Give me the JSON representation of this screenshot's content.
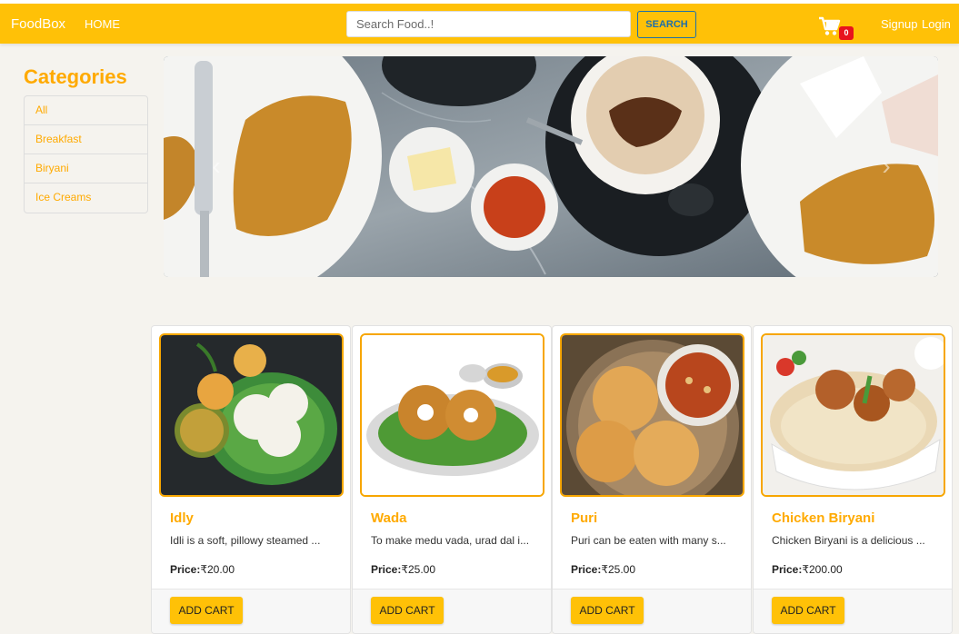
{
  "navbar": {
    "brand": "FoodBox",
    "home": "HOME",
    "search_placeholder": "Search Food..!",
    "search_button": "SEARCH",
    "cart_count": "0",
    "signup": "Signup",
    "login": "Login"
  },
  "categories": {
    "title": "Categories",
    "items": [
      "All",
      "Breakfast",
      "Biryani",
      "Ice Creams"
    ]
  },
  "carousel": {
    "prev_icon": "chevron-left-icon",
    "next_icon": "chevron-right-icon"
  },
  "products": [
    {
      "name": "Idly",
      "description": "Idli is a soft, pillowy steamed ...",
      "price_label": "Price:",
      "price": "₹20.00",
      "button": "ADD CART"
    },
    {
      "name": "Wada",
      "description": "To make medu vada, urad dal i...",
      "price_label": "Price:",
      "price": "₹25.00",
      "button": "ADD CART"
    },
    {
      "name": "Puri",
      "description": "Puri can be eaten with many s...",
      "price_label": "Price:",
      "price": "₹25.00",
      "button": "ADD CART"
    },
    {
      "name": "Chicken Biryani",
      "description": "Chicken Biryani is a delicious ...",
      "price_label": "Price:",
      "price": "₹200.00",
      "button": "ADD CART"
    }
  ],
  "colors": {
    "accent": "#ffc107",
    "brand_text": "#ffaa00",
    "badge": "#e8131d",
    "search_border": "#1f6fa8"
  }
}
